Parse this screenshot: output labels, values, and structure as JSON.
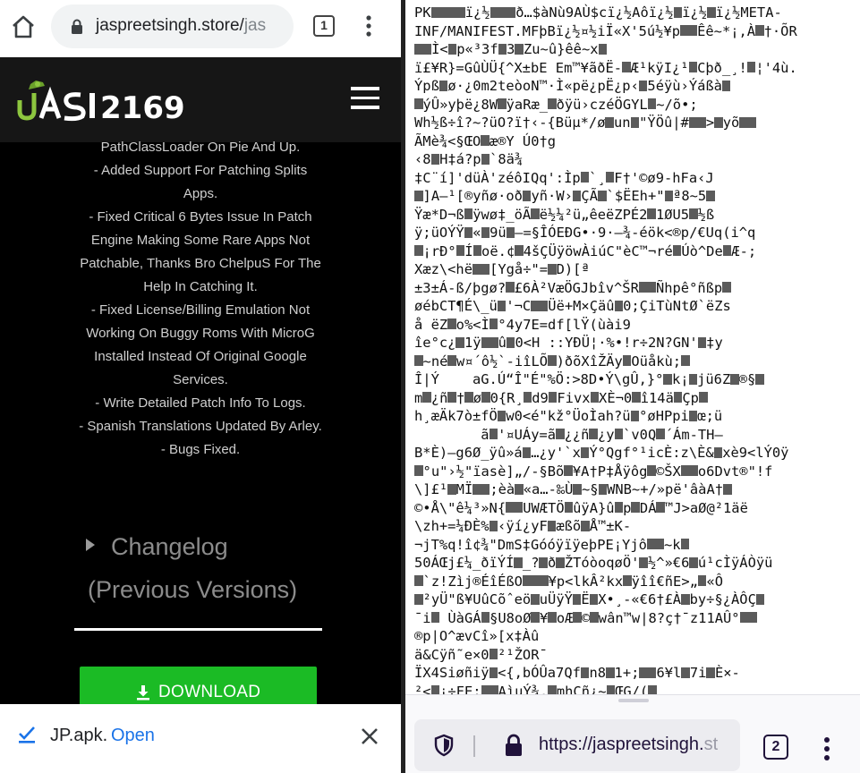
{
  "left_browser": {
    "url_host": "jaspreetsingh.store/",
    "url_path_fragment": "jas",
    "tab_count": "1",
    "icons": {
      "home": "home-icon",
      "lock": "lock-icon",
      "menu": "kebab-menu-icon"
    }
  },
  "site": {
    "logo_text": "JASI2169",
    "changelog_lines": [
      "PathClassLoader On Pie And Up.",
      "- Added Support For Patching Splits",
      "Apps.",
      "- Fixed Critical 6 Bytes Issue In Patch",
      "Engine Making Some Rare Apps Not",
      "Patchable, Thanks Bro ChelpuS For The",
      "Help In Catching It.",
      "- Fixed License/Billing Emulation Not",
      "Working On Buggy Roms With MicroG",
      "Installed Instead Of Original Google",
      "Services.",
      "- Write Detailed Patch Info To Logs.",
      "- Spanish Translations Updated By Arley.",
      "- Bugs Fixed."
    ],
    "prev_versions_line1": "Changelog",
    "prev_versions_line2": "(Previous Versions)",
    "download_label": "DOWNLOAD"
  },
  "download_notification": {
    "file_name": "JP.apk.",
    "open_label": "Open"
  },
  "right_browser": {
    "url_main": "https://jaspreetsingh.",
    "url_fade": "st",
    "tab_count": "2",
    "raw_lines": [
      "PK■■■■ï¿½■■■ð…$àNù9AÙ$cï¿½Aôï¿½■ï¿½■ï¿½META-",
      "INF/MANIFEST.MFþBï¿½¤½iÏ«X'5ú½¥p■■Êê~*¡,À■†·ÕR",
      "■■Ì<■p«³3f■3■Zu~û}êê~x■",
      "ï£¥R}=GûÙÜ{^X±bE Em™¥ãðË-■Æ¹kÿI¿¹■Cþð_¸!■¦'4ù.",
      "Ýpß■ø·¿0m2teòoN™·Ì«pë¿pË¿p‹■5éÿù›Ýáßà■",
      "■ýÛ»yþë¿8W■ÿaRæ_■ðÿü›czéÖGYL■~/õ•;",
      "Wh½ß÷î?~?üO?ï†‹-{Büµ*/ø■un■\"ŸÖû|#■■>■yõ■■",
      "ÃMè¾<§ŒO■æ®Y Ú0†g",
      "‹8■H‡á?p■`8ä¾",
      "‡C¨í]'düÀ'zéôIQq':Ìp■`¸■F†'©ø9-hFa‹J",
      "■]A—¹[®yñø·oð■yñ·W›■ÇÃ■`$ËEh+\"■ª8~5■",
      "Ÿæ*D¬ß■ÿwø‡_öÃ■ë½¼²ü„êeëZPÉ2■1ØU5■½ß",
      "ÿ;üOÝŸ■«■9ü■—=§ÎÓEÐG•·9·—¾-éök<®p/€Uq(i^q",
      "■¡rÐ°■Í■oë.¢■4šÇÜÿöwÀiúC\"èC™¬ré■Úò^De■Æ-;",
      "Xæz\\<hë■■[Ygå÷\"=■D)[ª",
      "±3±Á-ß/þgø?■£6À²VæÖGJbîv^ŠR■■Ñhpê°ñßp■",
      "øébCT¶É\\_ü■'¬C■■Üë+M×Çäû■0;ÇiTùNtØ`ëZs",
      "å ëZ■o%<Ì■°4y7E=df[lŸ(ùài9",
      "îe°c¿■1ÿ■■û■0<H ::YÐÜ¦·%•!r÷2N?GN'■‡y",
      "■~né■w¤´ô½`-iîLÕ■)ðõXîŽÄy■Oüåkù;■",
      "Î|Ý    aG.Ú“Î\"É\"%Ö:>8D•Ý\\gÛ,}°■k¡■jü6Z■®§■",
      "m■¿ñ■†■ø■0{R¸■d9■Fivx■XÈ¬0■î14ä■Çp■",
      "h¸æÄk7ò±fÖ■w0<é\"kž°ÜoÌah?ü■°øHPpi■œ;ü",
      "        ã■'¤UÁy=ã■¿¿ñ■¿y■`v0Q■´Ám-TH—",
      "B*È)—g6Ø_ÿû»á■…¿y'`x■Ý°Qgf°¹icÈ:z\\È&■xè9<lÝ0ÿ",
      "■°u\"›½\"ïasè]„/-§Bõ■¥A†P‡Åÿôg■©ŠX■■o6Dvt®\"!f",
      "\\]£¹■MÏ■■;èà■«a…-‰Ù■~§■WNB~+/»pë'âàA†■",
      "©•Å\\\"ê¼³»N{■■UWÆTÖ■ûÿA}û■p■DÁ■™J>aØ@²1äë",
      "\\zh+=¼ÐÈ%■‹ÿí¿yF■æßõ■Å™±K-",
      "¬jT%q!î¢¾\"DmS‡GóóÿïÿeþPE¡Yjô■■~k■",
      "50ÁŒj£¼_ðïÝÍ■_?■ð■ŽTóòoqøÖ'■½^»€6■ú¹cÌÿÁÒÿü",
      "■`z!Zìj®ÉîÉßO■■■¥p<lkÂ²kx■ÿîî€ñE>„■«Ô",
      "■²yÜ\"ß¥UûCõˆeö■uÜÿŸ■Ë■X•¸-«€6†£À■by÷§¿ÀÔÇ■",
      "¯i■ ÙàGÁ■§U8oØ■¥■oÆ■©■wân™w|8?ç†¯z11AÛ°■■",
      "®p|O^ævCî»[x‡Àû",
      "ä&Cÿñ˜e×0■²¹ŽOR¯",
      "ÏX4Siøñiÿ■<{,bÓÛa7Qf■n8■1+;■■6¥l■7i■È×-",
      "²<■¡÷FE;■■AìuÝ¾.■mhCñ¿~■ŒG/(■"
    ]
  }
}
